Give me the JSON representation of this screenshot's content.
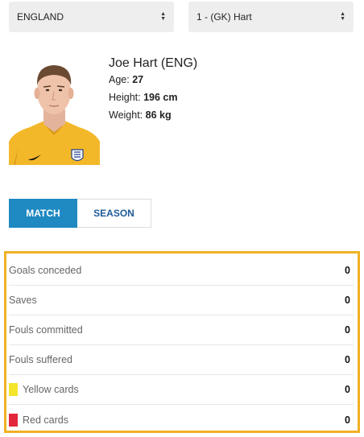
{
  "selectors": {
    "team": "ENGLAND",
    "player": "1 - (GK) Hart"
  },
  "player": {
    "name": "Joe Hart (ENG)",
    "age_label": "Age:",
    "age": "27",
    "height_label": "Height:",
    "height": "196 cm",
    "weight_label": "Weight:",
    "weight": "86 kg"
  },
  "tabs": {
    "match": "MATCH",
    "season": "SEASON"
  },
  "stats": [
    {
      "label": "Goals conceded",
      "value": "0"
    },
    {
      "label": "Saves",
      "value": "0"
    },
    {
      "label": "Fouls committed",
      "value": "0"
    },
    {
      "label": "Fouls suffered",
      "value": "0"
    },
    {
      "label": "Yellow cards",
      "value": "0",
      "card_color": "#f5e52b"
    },
    {
      "label": "Red cards",
      "value": "0",
      "card_color": "#e2263b"
    }
  ],
  "colors": {
    "accent_blue": "#1f89c2",
    "highlight_border": "#f0b125",
    "jersey_yellow": "#f3b82a"
  }
}
